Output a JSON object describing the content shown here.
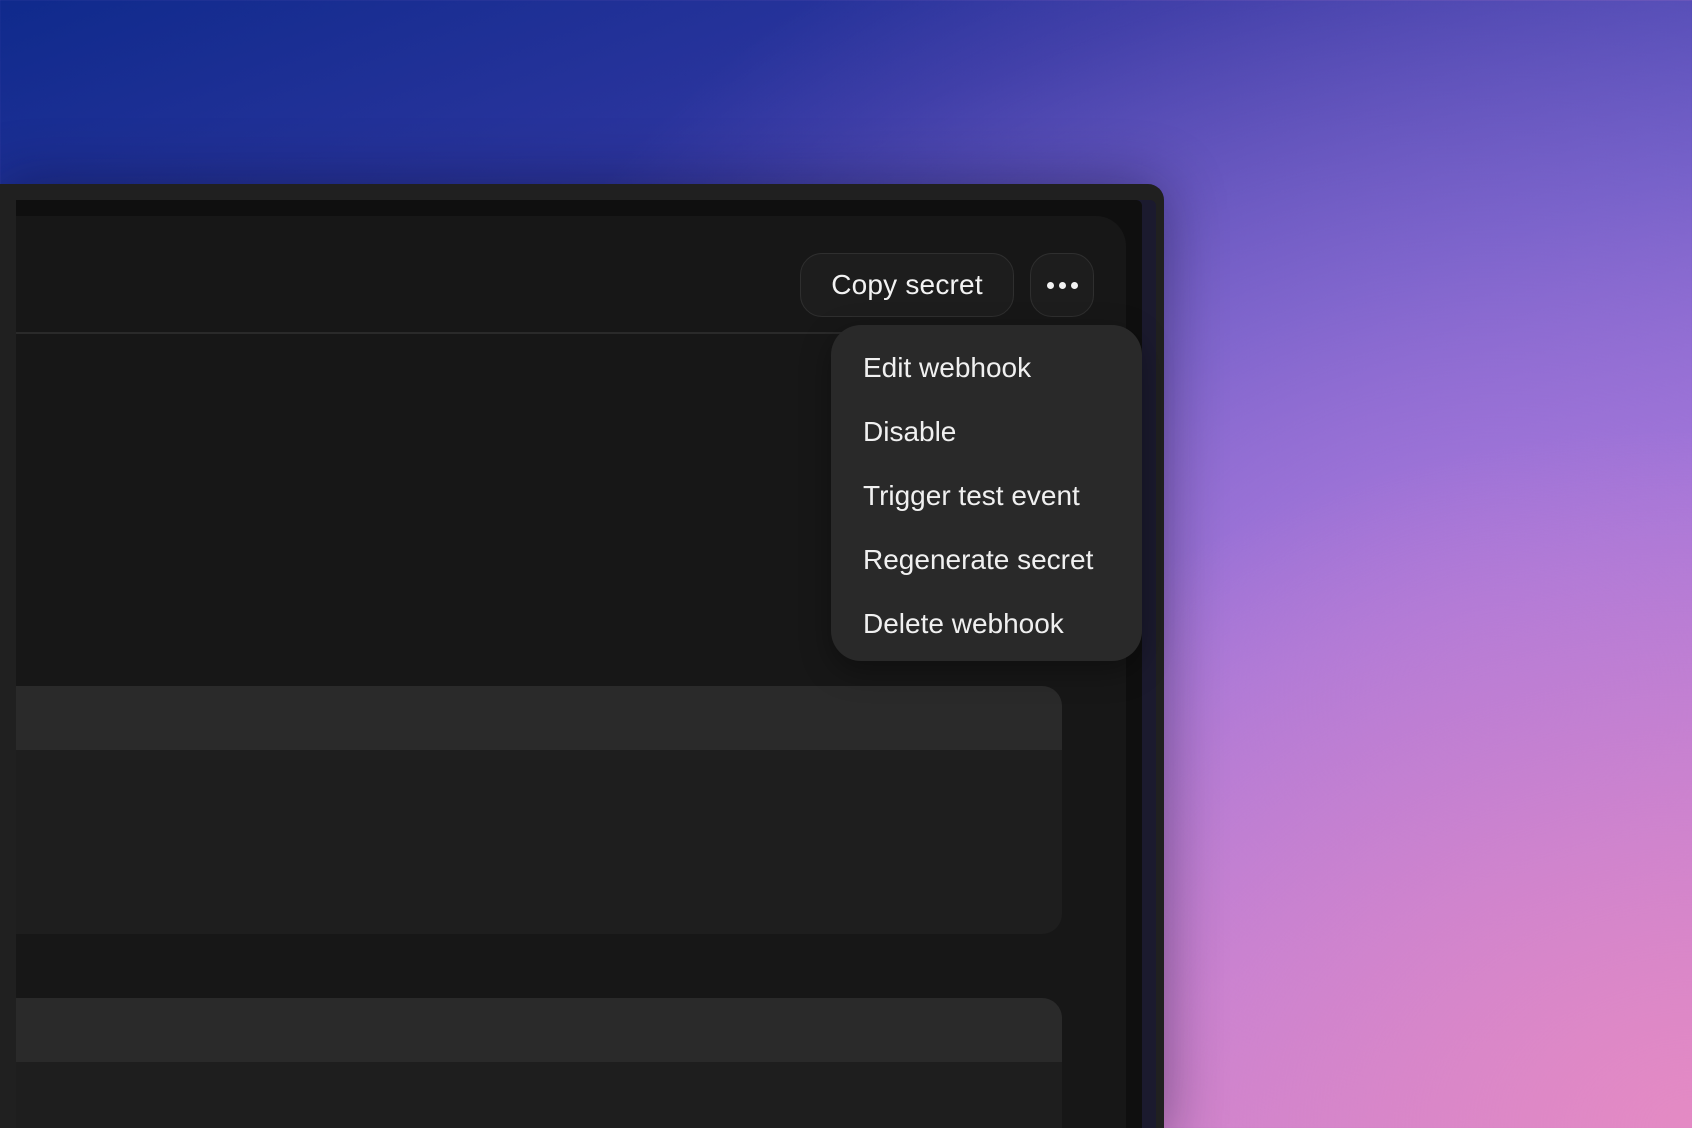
{
  "header": {
    "copy_secret_label": "Copy secret",
    "more_icon": "ellipsis-horizontal-icon"
  },
  "menu": {
    "items": [
      {
        "label": "Edit webhook"
      },
      {
        "label": "Disable"
      },
      {
        "label": "Trigger test event"
      },
      {
        "label": "Regenerate secret"
      },
      {
        "label": "Delete webhook"
      }
    ]
  },
  "colors": {
    "panel_bg": "#171717",
    "menu_bg": "#292929",
    "card_bg": "#1e1e1e",
    "card_header_bg": "#2a2a2a",
    "text": "#f2f2f2"
  }
}
